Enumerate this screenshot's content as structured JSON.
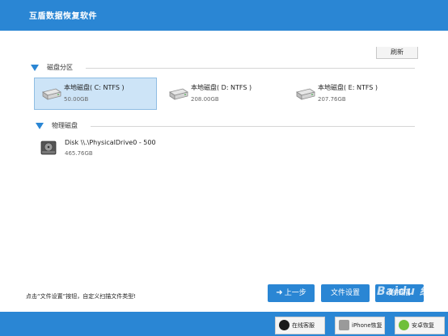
{
  "app": {
    "title": "互盾数据恢复软件"
  },
  "toolbar": {
    "refresh_label": "刷新"
  },
  "sections": {
    "partitions": {
      "label": "磁盘分区"
    },
    "physical": {
      "label": "物理磁盘"
    }
  },
  "drives": [
    {
      "name": "本地磁盘( C: NTFS )",
      "size": "50.00GB",
      "selected": true
    },
    {
      "name": "本地磁盘( D: NTFS )",
      "size": "208.00GB",
      "selected": false
    },
    {
      "name": "本地磁盘( E: NTFS )",
      "size": "207.76GB",
      "selected": false
    }
  ],
  "physical_disks": [
    {
      "name": "Disk \\\\.\\PhysicalDrive0 - 500",
      "size": "465.76GB"
    }
  ],
  "footer": {
    "hint": "点击“文件设置”按钮，自定义扫描文件类型!",
    "prev_label": "上一步",
    "settings_label": "文件设置",
    "scan_label": "始扫描"
  },
  "bottom": {
    "support_label": "在线客服",
    "iphone_label": "iPhone恢复",
    "android_label": "安卓恢复"
  },
  "watermark": "Baidu 经验",
  "colors": {
    "accent": "#2a86d4",
    "selected_bg": "#cde4f7"
  },
  "icons": {
    "section_toggle": "triangle-down-icon",
    "drive": "hard-drive-icon",
    "physical_disk": "physical-disk-icon",
    "prev": "arrow-left-icon",
    "support": "qq-penguin-icon",
    "iphone": "iphone-icon",
    "android": "android-icon"
  }
}
